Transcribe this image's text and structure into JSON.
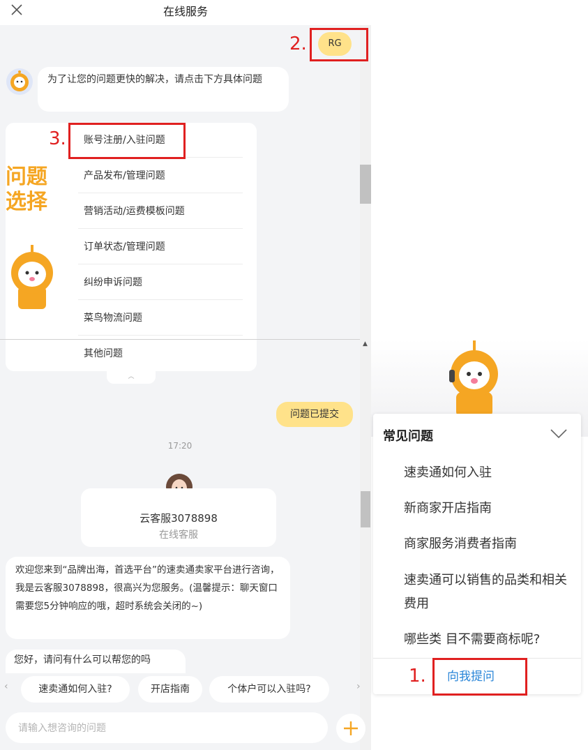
{
  "header": {
    "title": "在线服务",
    "close_icon": "close-icon"
  },
  "annotations": {
    "n1": "1.",
    "n2": "2.",
    "n3": "3."
  },
  "user_avatar_label": "RG",
  "bot_prompt": "为了让您的问题更快的解决，请点击下方具体问题",
  "problem_select_label": [
    "问题",
    "选择"
  ],
  "menu_items": [
    "账号注册/入驻问题",
    "产品发布/管理问题",
    "营销活动/运费模板问题",
    "订单状态/管理问题",
    "纠纷申诉问题",
    "菜鸟物流问题",
    "其他问题"
  ],
  "user_message": "问题已提交",
  "timestamp": "17:20",
  "agent": {
    "name": "云客服3078898",
    "status": "在线客服"
  },
  "welcome_message": "欢迎您来到“品牌出海，首选平台”的速卖通卖家平台进行咨询，我是云客服3078898，很高兴为您服务。(温馨提示：聊天窗口需要您5分钟响应的哦，超时系统会关闭的~)",
  "greeting": "您好，请问有什么可以帮您的吗",
  "quick_chips": [
    "速卖通如何入驻?",
    "开店指南",
    "个体户可以入驻吗?"
  ],
  "input": {
    "placeholder": "请输入想咨询的问题"
  },
  "faq": {
    "title": "常见问题",
    "items": [
      "速卖通如何入驻",
      "新商家开店指南",
      "商家服务消费者指南",
      "速卖通可以销售的品类和相关费用",
      "哪些类 目不需要商标呢?"
    ],
    "ask_label": "向我提问"
  },
  "colors": {
    "accent_yellow": "#ffe28a",
    "brand_orange": "#f5a623",
    "annotation_red": "#e02020",
    "link_blue": "#2a86d8"
  }
}
